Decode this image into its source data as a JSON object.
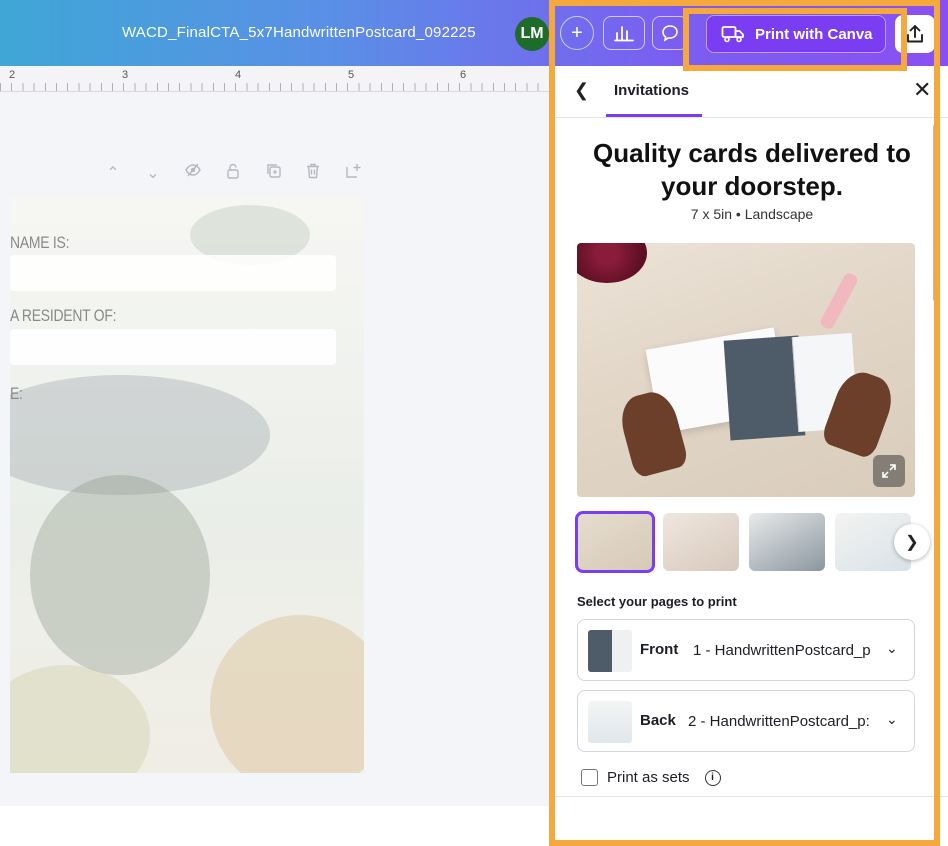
{
  "topbar": {
    "doc_title": "WACD_FinalCTA_5x7HandwrittenPostcard_092225",
    "avatar_initials": "LM",
    "print_button_label": "Print with Canva"
  },
  "ruler": {
    "numbers": [
      "2",
      "3",
      "4",
      "5",
      "6"
    ]
  },
  "postcard": {
    "labels": [
      "NAME IS:",
      "A RESIDENT OF:",
      "E:"
    ]
  },
  "panel": {
    "tab_title": "Invitations",
    "headline_line1": "Quality cards delivered to",
    "headline_line2": "your doorstep.",
    "subheadline": "7 x 5in • Landscape",
    "select_pages_label": "Select your pages to print",
    "pages": [
      {
        "side": "Front",
        "name": "1 - HandwrittenPostcard_p"
      },
      {
        "side": "Back",
        "name": "2 - HandwrittenPostcard_p:"
      }
    ],
    "print_as_sets_label": "Print as sets"
  },
  "colors": {
    "accent": "#7b3df2",
    "highlight": "#f5a83c",
    "avatar": "#1f6b2a"
  }
}
